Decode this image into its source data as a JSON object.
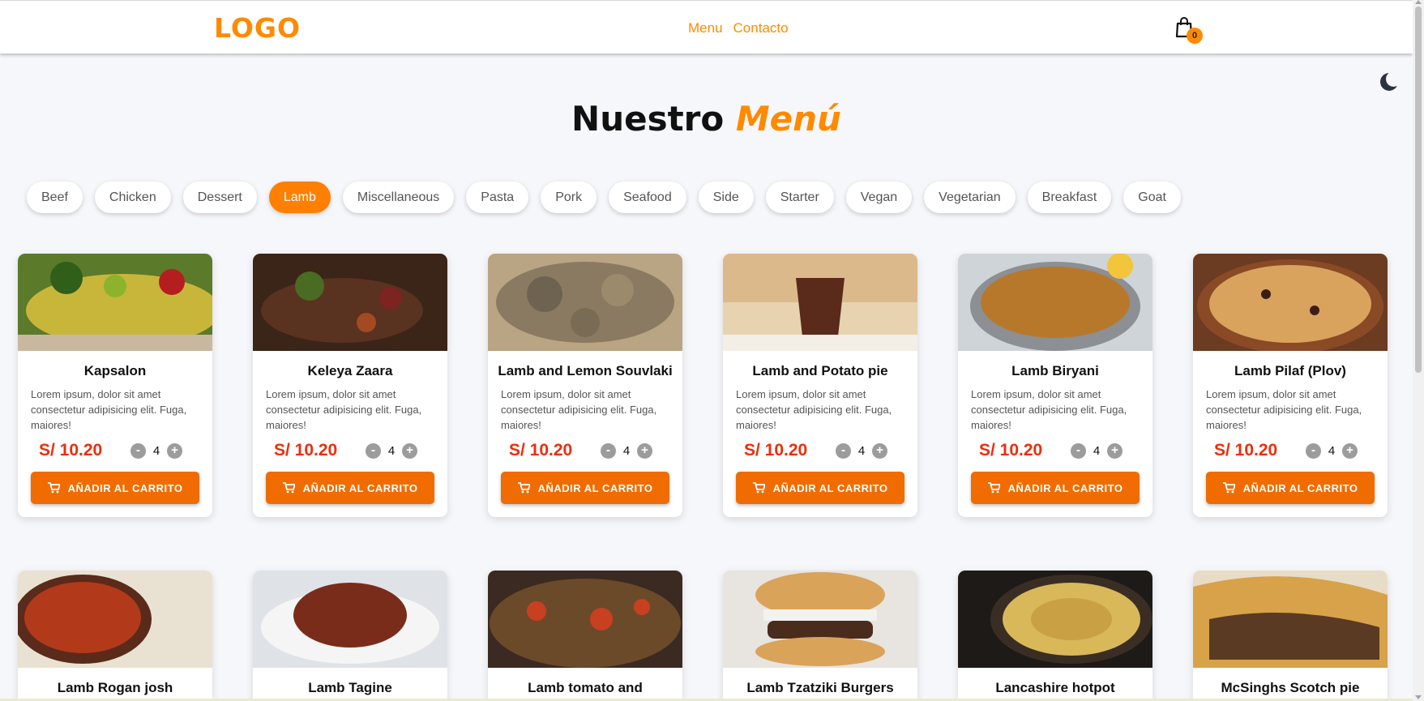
{
  "header": {
    "logo": "LOGO",
    "nav": [
      {
        "label": "Menu"
      },
      {
        "label": "Contacto"
      }
    ],
    "cart_count": "0"
  },
  "title": {
    "prefix": "Nuestro",
    "accent": "Menú"
  },
  "categories": [
    "Beef",
    "Chicken",
    "Dessert",
    "Lamb",
    "Miscellaneous",
    "Pasta",
    "Pork",
    "Seafood",
    "Side",
    "Starter",
    "Vegan",
    "Vegetarian",
    "Breakfast",
    "Goat"
  ],
  "active_category": "Lamb",
  "colors": {
    "accent": "#ff8a00",
    "button": "#f06c00",
    "price": "#ee2d0a"
  },
  "cards": [
    {
      "name": "Kapsalon",
      "desc": "Lorem ipsum, dolor sit amet consectetur adipisicing elit. Fuga, maiores!",
      "price": "S/ 10.20",
      "qty": "4",
      "button": "AÑADIR AL CARRITO"
    },
    {
      "name": "Keleya Zaara",
      "desc": "Lorem ipsum, dolor sit amet consectetur adipisicing elit. Fuga, maiores!",
      "price": "S/ 10.20",
      "qty": "4",
      "button": "AÑADIR AL CARRITO"
    },
    {
      "name": "Lamb and Lemon Souvlaki",
      "desc": "Lorem ipsum, dolor sit amet consectetur adipisicing elit. Fuga, maiores!",
      "price": "S/ 10.20",
      "qty": "4",
      "button": "AÑADIR AL CARRITO"
    },
    {
      "name": "Lamb and Potato pie",
      "desc": "Lorem ipsum, dolor sit amet consectetur adipisicing elit. Fuga, maiores!",
      "price": "S/ 10.20",
      "qty": "4",
      "button": "AÑADIR AL CARRITO"
    },
    {
      "name": "Lamb Biryani",
      "desc": "Lorem ipsum, dolor sit amet consectetur adipisicing elit. Fuga, maiores!",
      "price": "S/ 10.20",
      "qty": "4",
      "button": "AÑADIR AL CARRITO"
    },
    {
      "name": "Lamb Pilaf (Plov)",
      "desc": "Lorem ipsum, dolor sit amet consectetur adipisicing elit. Fuga, maiores!",
      "price": "S/ 10.20",
      "qty": "4",
      "button": "AÑADIR AL CARRITO"
    },
    {
      "name": "Lamb Rogan josh"
    },
    {
      "name": "Lamb Tagine"
    },
    {
      "name": "Lamb tomato and"
    },
    {
      "name": "Lamb Tzatziki Burgers"
    },
    {
      "name": "Lancashire hotpot"
    },
    {
      "name": "McSinghs Scotch pie"
    }
  ],
  "icons": {
    "cart": "shopping-bag-icon",
    "theme": "moon-icon",
    "add": "cart-icon",
    "minus": "minus-icon",
    "plus": "plus-icon"
  }
}
